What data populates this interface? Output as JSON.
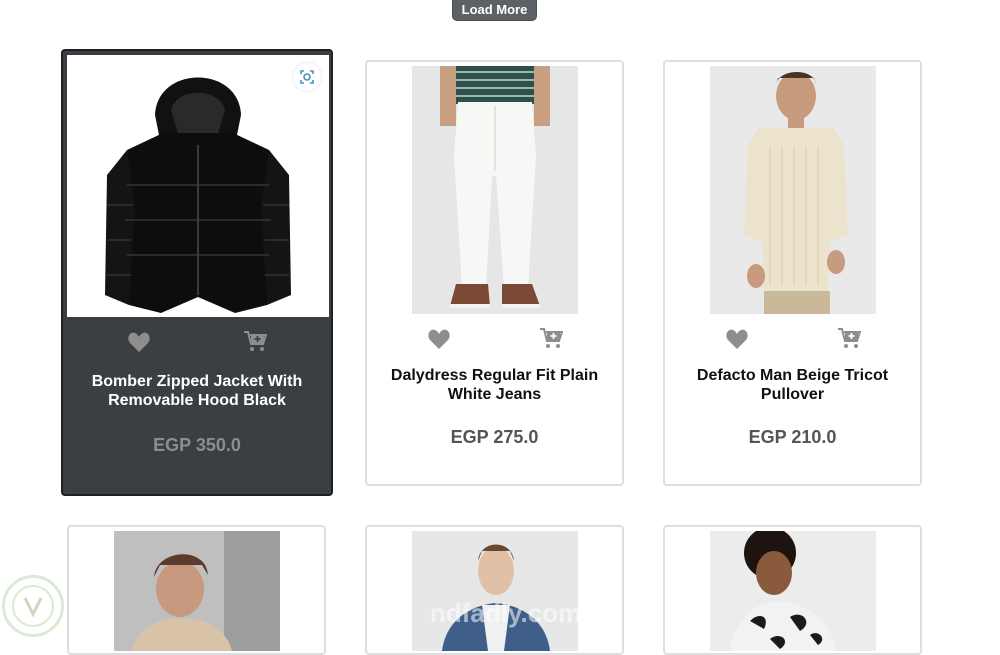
{
  "load_more_label": "Load More",
  "currency": "EGP",
  "colors": {
    "active_card_bg": "#3b3e43",
    "icon_gray": "#8e8e8e",
    "price_gray": "#555555"
  },
  "products": [
    {
      "title": "Bomber Zipped Jacket With Removable Hood Black",
      "price": "EGP 350.0",
      "image": "black-puffer-jacket",
      "active": true
    },
    {
      "title": "Dalydress Regular Fit Plain White Jeans",
      "price": "EGP 275.0",
      "image": "white-jeans"
    },
    {
      "title": "Defacto Man Beige Tricot Pullover",
      "price": "EGP 210.0",
      "image": "beige-pullover"
    },
    {
      "image": "man-beige-tshirt"
    },
    {
      "image": "man-denim-vest"
    },
    {
      "image": "man-floral-shirt"
    }
  ],
  "icons": {
    "favorite": "heart-icon",
    "cart": "add-to-cart-icon",
    "zoom": "zoom-icon"
  },
  "watermark_text": "ndfadly.com"
}
